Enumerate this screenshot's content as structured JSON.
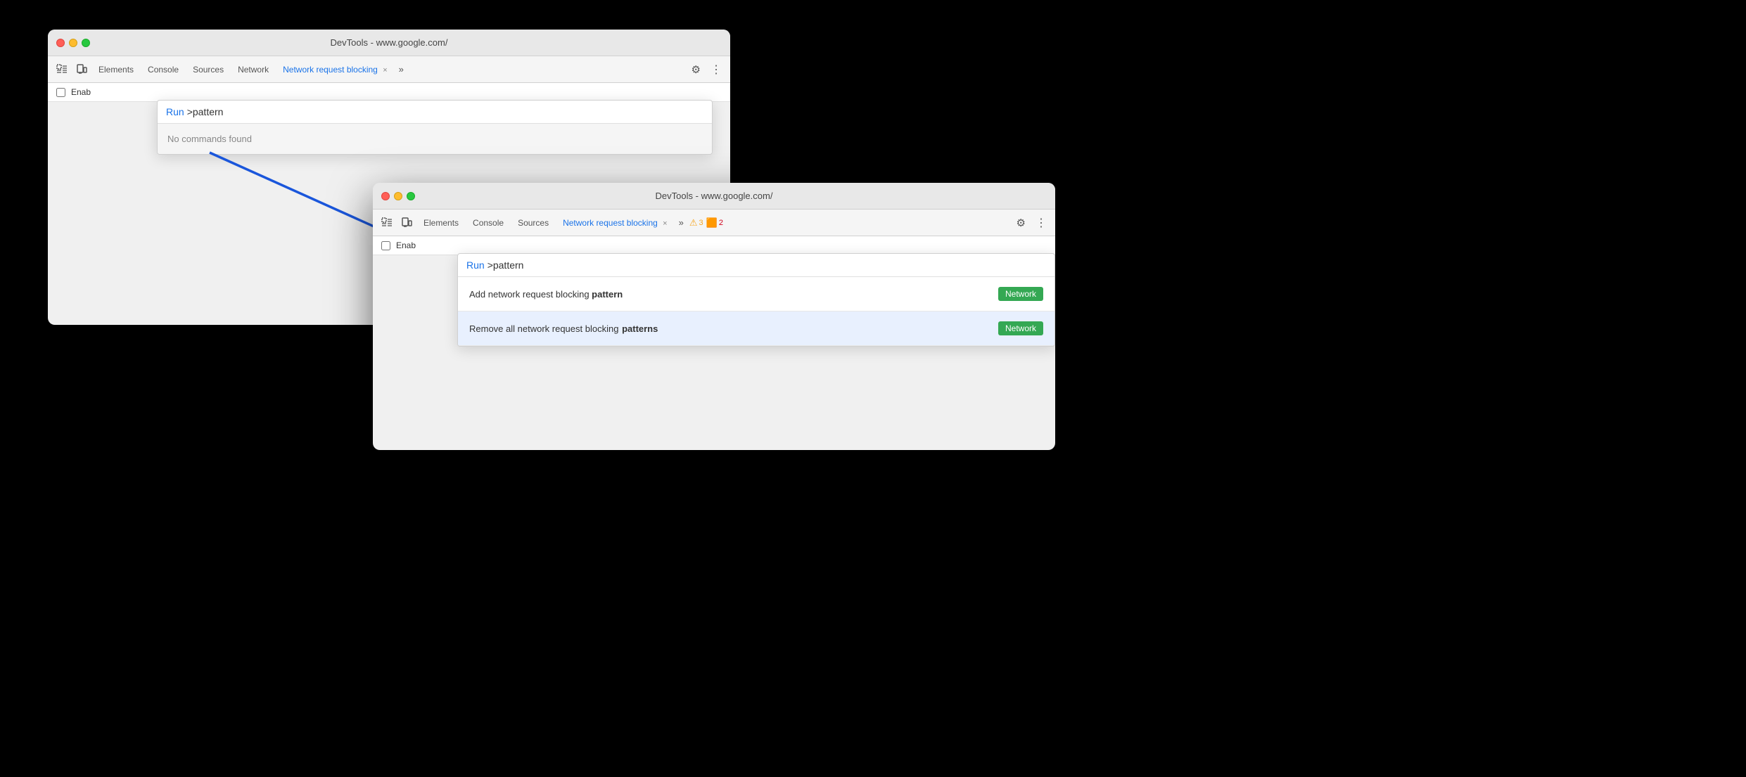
{
  "window1": {
    "titlebar_text": "DevTools - www.google.com/",
    "tabs": [
      {
        "label": "Elements",
        "active": false
      },
      {
        "label": "Console",
        "active": false
      },
      {
        "label": "Sources",
        "active": false
      },
      {
        "label": "Network",
        "active": false
      },
      {
        "label": "Network request blocking",
        "active": true
      }
    ],
    "enable_label": "Enab",
    "cmd_run": "Run",
    "cmd_text": ">pattern",
    "cmd_no_results": "No commands found"
  },
  "window2": {
    "titlebar_text": "DevTools - www.google.com/",
    "tabs": [
      {
        "label": "Elements",
        "active": false
      },
      {
        "label": "Console",
        "active": false
      },
      {
        "label": "Sources",
        "active": false
      },
      {
        "label": "Network request blocking",
        "active": true
      }
    ],
    "enable_label": "Enab",
    "warning_count": "3",
    "error_count": "2",
    "cmd_run": "Run",
    "cmd_text": ">pattern",
    "results": [
      {
        "text_before": "Add network request blocking ",
        "text_bold": "pattern",
        "text_after": "",
        "badge": "Network",
        "highlighted": false
      },
      {
        "text_before": "Remove all network request blocking ",
        "text_bold": "patterns",
        "text_after": "",
        "badge": "Network",
        "highlighted": true
      }
    ]
  },
  "icons": {
    "close": "×",
    "chevron": "»",
    "gear": "⚙",
    "dots": "⋮",
    "warning": "⚠",
    "error": "🟧"
  }
}
